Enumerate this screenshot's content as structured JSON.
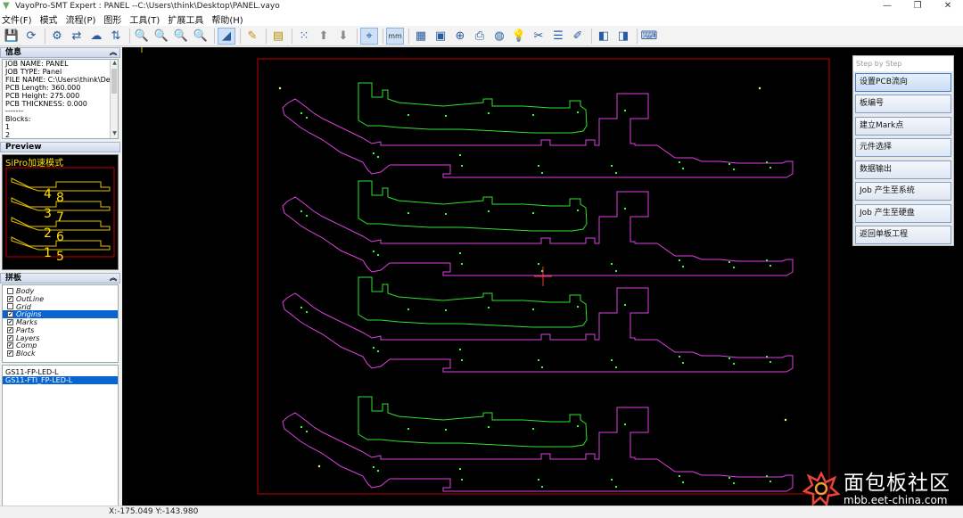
{
  "window": {
    "title": "VayoPro-SMT Expert : PANEL  --C:\\Users\\think\\Desktop\\PANEL.vayo",
    "controls": [
      "—",
      "❐",
      "✕"
    ]
  },
  "menu": [
    "文件(F)",
    "模式",
    "流程(P)",
    "图形",
    "工具(T)",
    "扩展工具",
    "帮助(H)"
  ],
  "info_panel": {
    "title": "信息",
    "lines": [
      "JOB NAME: PANEL",
      "JOB TYPE: Panel",
      "FILE NAME: C:\\Users\\think\\Deskto",
      "PCB Length: 360.000",
      "PCB Height: 275.000",
      "PCB THICKNESS: 0.000",
      "-------",
      "Blocks:",
      "1",
      "2"
    ]
  },
  "preview_panel": {
    "title": "Preview",
    "overlay_text": "SiPro加速模式",
    "block_numbers": [
      "4",
      "8",
      "3",
      "7",
      "2",
      "6",
      "1",
      "5"
    ]
  },
  "layer_panel": {
    "title": "拼板",
    "layers": [
      {
        "name": "Body",
        "checked": false,
        "selected": false
      },
      {
        "name": "OutLine",
        "checked": true,
        "selected": false
      },
      {
        "name": "Grid",
        "checked": false,
        "selected": false
      },
      {
        "name": "Origins",
        "checked": true,
        "selected": true
      },
      {
        "name": "Marks",
        "checked": true,
        "selected": false
      },
      {
        "name": "Parts",
        "checked": true,
        "selected": false
      },
      {
        "name": "Layers",
        "checked": true,
        "selected": false
      },
      {
        "name": "Comp",
        "checked": true,
        "selected": false
      },
      {
        "name": "Block",
        "checked": true,
        "selected": false
      }
    ]
  },
  "board_list": [
    {
      "name": "GS11-FP-LED-L",
      "selected": false
    },
    {
      "name": "GS11-FTI_FP-LED-L",
      "selected": true
    }
  ],
  "step_panel": {
    "title": "Step by Step",
    "buttons": [
      "设置PCB流向",
      "板编号",
      "建立Mark点",
      "元件选择",
      "数据输出",
      "Job 产生至系统",
      "Job 产生至硬盘",
      "返回单板工程"
    ]
  },
  "status": {
    "coordinates": "X:-175.049 Y:-143.980"
  },
  "watermark": {
    "title": "面包板社区",
    "url": "mbb.eet-china.com"
  },
  "colors": {
    "canvas_bg": "#000000",
    "panel_border": "#c00000",
    "board_outline": "#e040e0",
    "component_outline": "#30e030",
    "pads": "#30ff30",
    "selection": "#0a64d0"
  }
}
